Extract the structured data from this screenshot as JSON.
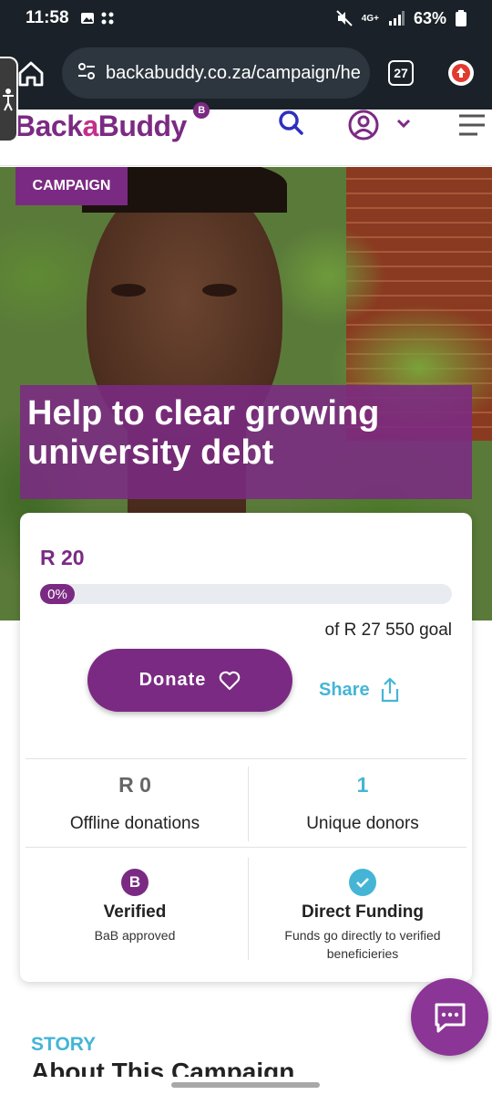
{
  "status_bar": {
    "time": "11:58",
    "network": "4G+",
    "battery": "63%"
  },
  "browser": {
    "url": "backabuddy.co.za/campaign/he",
    "tab_count": "27"
  },
  "header": {
    "logo_text_1": "Back",
    "logo_text_2": "a",
    "logo_text_3": "Buddy",
    "logo_badge": "B"
  },
  "hero": {
    "tag": "CAMPAIGN",
    "title": "Help to clear growing university debt"
  },
  "campaign": {
    "raised": "R 20",
    "progress_label": "0%",
    "progress_value": 0,
    "goal": "of R 27 550 goal",
    "donate_label": "Donate",
    "share_label": "Share"
  },
  "stats": {
    "offline_value": "R 0",
    "offline_label": "Offline donations",
    "donors_value": "1",
    "donors_label": "Unique donors"
  },
  "features": {
    "verified_icon": "B",
    "verified_title": "Verified",
    "verified_sub": "BaB approved",
    "direct_title": "Direct Funding",
    "direct_sub": "Funds go directly to verified beneficieries"
  },
  "story": {
    "label": "STORY",
    "title": "About This Campaign"
  },
  "colors": {
    "brand_purple": "#7b2a83",
    "accent_blue": "#45b5d6"
  }
}
